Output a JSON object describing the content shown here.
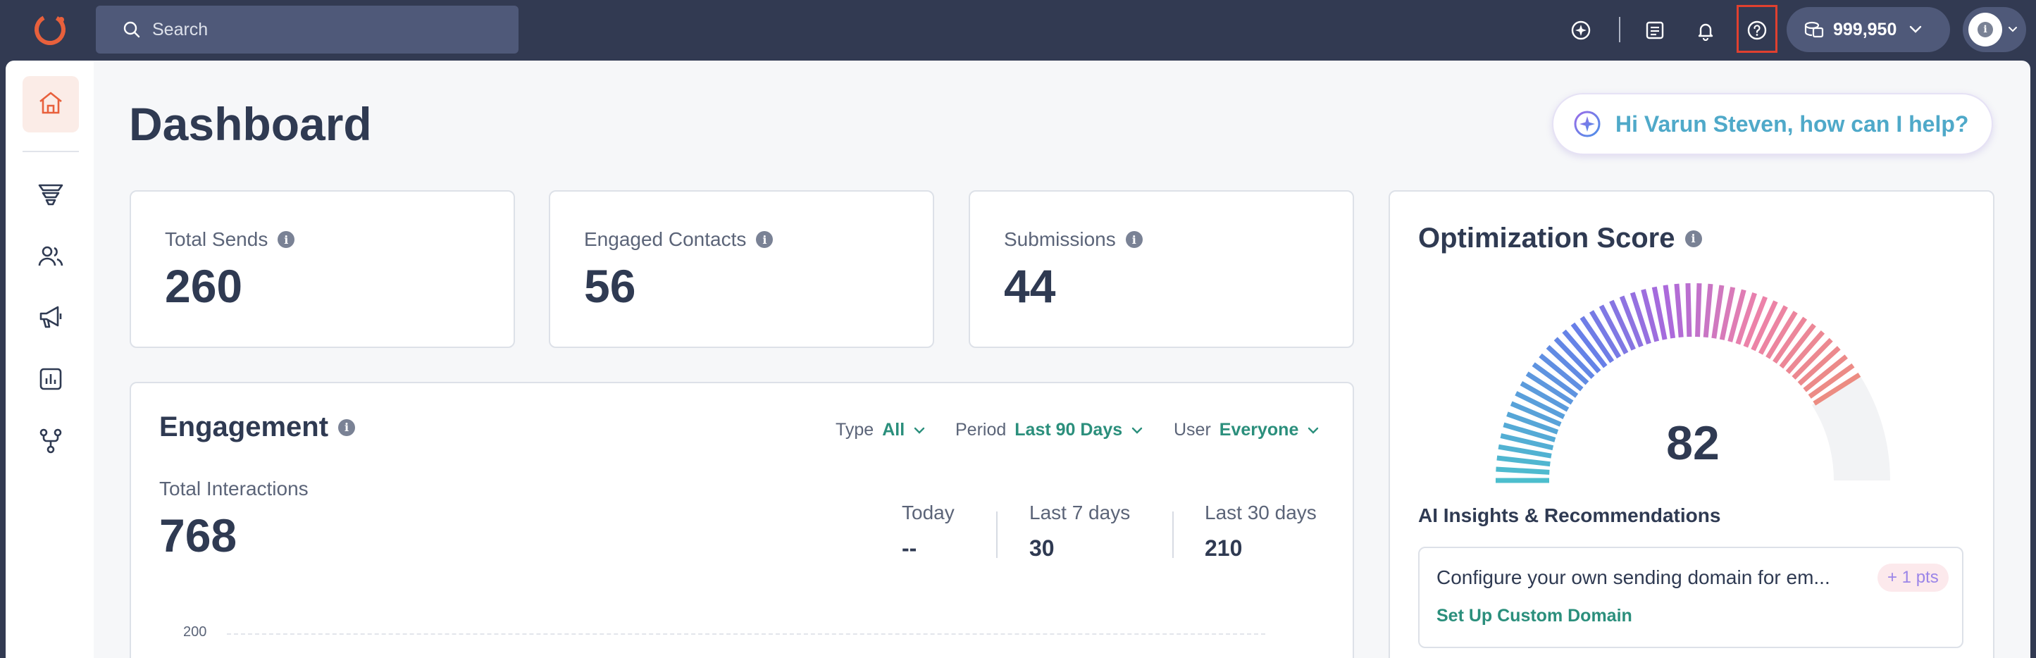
{
  "topbar": {
    "logo_icon": "app-logo-ring",
    "search_placeholder": "Search",
    "icons": [
      "ai-assistant-icon",
      "document-list-icon",
      "bell-icon",
      "help-icon",
      "credits-stack-icon",
      "chevron-down-icon"
    ],
    "credits": "999,950",
    "avatar_initial": "i"
  },
  "sidebar": {
    "items": [
      {
        "name": "home",
        "icon": "home-icon",
        "active": true
      },
      {
        "name": "funnel",
        "icon": "funnel-icon"
      },
      {
        "name": "contacts",
        "icon": "contacts-icon"
      },
      {
        "name": "campaigns",
        "icon": "megaphone-icon"
      },
      {
        "name": "reports",
        "icon": "bar-chart-icon"
      },
      {
        "name": "workflows",
        "icon": "workflow-icon"
      }
    ]
  },
  "main": {
    "title": "Dashboard",
    "ai_prompt": "Hi Varun Steven, how can I help?",
    "stats": [
      {
        "label": "Total Sends",
        "value": "260"
      },
      {
        "label": "Engaged Contacts",
        "value": "56"
      },
      {
        "label": "Submissions",
        "value": "44"
      }
    ],
    "engagement": {
      "title": "Engagement",
      "filters": {
        "type_label": "Type",
        "type_value": "All",
        "period_label": "Period",
        "period_value": "Last 90 Days",
        "user_label": "User",
        "user_value": "Everyone"
      },
      "total_label": "Total Interactions",
      "total_value": "768",
      "periods": [
        {
          "label": "Today",
          "value": "--"
        },
        {
          "label": "Last 7 days",
          "value": "30"
        },
        {
          "label": "Last 30 days",
          "value": "210"
        }
      ],
      "y_axis_tick": "200"
    },
    "optimization": {
      "title": "Optimization Score",
      "score": "82",
      "score_fraction": 0.82,
      "insights_title": "AI Insights & Recommendations",
      "recommendation": {
        "text": "Configure your own sending domain for em...",
        "points": "+ 1 pts",
        "action": "Set Up Custom Domain"
      }
    }
  },
  "colors": {
    "topbar": "#323a52",
    "accent": "#e8603c",
    "link": "#2b8f7c",
    "highlight_box": "#e0402f"
  }
}
